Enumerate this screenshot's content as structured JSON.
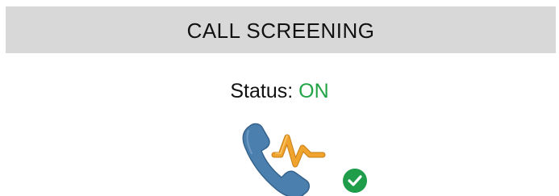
{
  "header": {
    "title": "CALL SCREENING"
  },
  "status": {
    "label": "Status:",
    "value": "ON",
    "value_color": "#21a346"
  },
  "icon": {
    "name": "call-screening-icon",
    "badge": "check-badge-icon",
    "phone_color": "#4b7fae",
    "wave_color": "#f0a42d",
    "badge_color": "#1f9d4a"
  }
}
